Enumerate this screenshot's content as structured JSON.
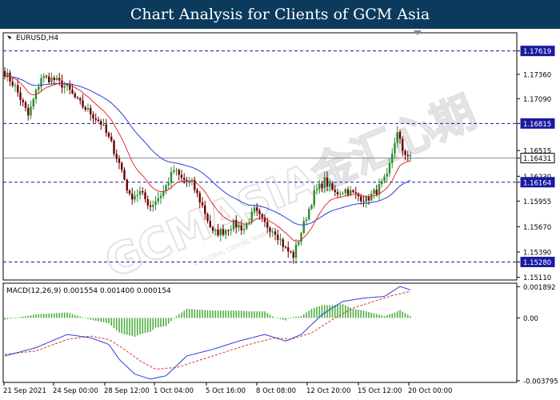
{
  "banner": {
    "title": "Chart Analysis for Clients of GCM Asia"
  },
  "watermark": {
    "text": "GCMASIA金汇心期",
    "subtext": "© GLOBAL CAPITAL MARKETS"
  },
  "colors": {
    "banner": "#0b3a5c",
    "bull_candle": "#2e8b2e",
    "bear_candle": "#6b0000",
    "ma_fast": "#e03030",
    "ma_slow": "#2a3fd6",
    "level": "#1a1aa0",
    "price_line": "#7a8aa0",
    "macd_hist": "#4caf40",
    "macd_line": "#2a3fd6",
    "signal_line": "#e03030"
  },
  "chart_data": [
    {
      "type": "candlestick",
      "title": "EURUSD,H4",
      "x_labels": [
        "21 Sep 2021",
        "24 Sep 00:00",
        "28 Sep 12:00",
        "1 Oct 04:00",
        "5 Oct 16:00",
        "8 Oct 08:00",
        "12 Oct 20:00",
        "15 Oct 12:00",
        "20 Oct 00:00"
      ],
      "y_ticks": [
        1.17619,
        1.1736,
        1.1709,
        1.16815,
        1.16515,
        1.1623,
        1.16164,
        1.15955,
        1.1567,
        1.1539,
        1.1528,
        1.1511
      ],
      "ylim": [
        1.1508,
        1.1782
      ],
      "current_price": 1.16431,
      "horizontal_levels": [
        1.17619,
        1.16815,
        1.16164,
        1.1528
      ],
      "highlighted_labels": [
        "1.17619",
        "1.16815",
        "1.16431",
        "1.16164",
        "1.15280"
      ],
      "axis_label_texts": [
        "1.17619",
        "1.17360",
        "1.17090",
        "1.16815",
        "1.16515",
        "1.16431",
        "1.16230",
        "1.16164",
        "1.15955",
        "1.15670",
        "1.15390",
        "1.15280",
        "1.15110"
      ],
      "series": [
        {
          "name": "price",
          "key_close_points": [
            [
              0,
              1.1738
            ],
            [
              4,
              1.1722
            ],
            [
              9,
              1.169
            ],
            [
              14,
              1.1733
            ],
            [
              19,
              1.173
            ],
            [
              24,
              1.1721
            ],
            [
              28,
              1.1706
            ],
            [
              33,
              1.1693
            ],
            [
              37,
              1.1682
            ],
            [
              41,
              1.1659
            ],
            [
              45,
              1.163
            ],
            [
              48,
              1.16
            ],
            [
              52,
              1.1605
            ],
            [
              56,
              1.159
            ],
            [
              61,
              1.1606
            ],
            [
              65,
              1.163
            ],
            [
              68,
              1.162
            ],
            [
              72,
              1.1615
            ],
            [
              76,
              1.159
            ],
            [
              80,
              1.156
            ],
            [
              84,
              1.1562
            ],
            [
              88,
              1.157
            ],
            [
              92,
              1.1565
            ],
            [
              96,
              1.1585
            ],
            [
              100,
              1.157
            ],
            [
              104,
              1.1562
            ],
            [
              108,
              1.1542
            ],
            [
              111,
              1.1535
            ],
            [
              115,
              1.157
            ],
            [
              119,
              1.1604
            ],
            [
              123,
              1.1618
            ],
            [
              127,
              1.1604
            ],
            [
              131,
              1.1608
            ],
            [
              135,
              1.1602
            ],
            [
              139,
              1.1597
            ],
            [
              143,
              1.1607
            ],
            [
              147,
              1.1622
            ],
            [
              150,
              1.1662
            ],
            [
              151,
              1.167
            ],
            [
              153,
              1.1652
            ],
            [
              156,
              1.1643
            ]
          ]
        }
      ]
    },
    {
      "type": "line",
      "title": "MACD(12,26,9) 0.001554 0.001400 0.000154",
      "y_ticks": [
        0.001892,
        0.0,
        -0.003795
      ],
      "axis_label_texts": [
        "0.001892",
        "0.00",
        "-0.003795"
      ],
      "ylim": [
        -0.0039,
        0.0021
      ],
      "series": [
        {
          "name": "macd",
          "key_points": [
            [
              0,
              -0.0023
            ],
            [
              12,
              -0.0018
            ],
            [
              24,
              -0.001
            ],
            [
              33,
              -0.0012
            ],
            [
              40,
              -0.0016
            ],
            [
              44,
              -0.0025
            ],
            [
              50,
              -0.0034
            ],
            [
              56,
              -0.0037
            ],
            [
              62,
              -0.0035
            ],
            [
              70,
              -0.0023
            ],
            [
              80,
              -0.0019
            ],
            [
              90,
              -0.0014
            ],
            [
              100,
              -0.001
            ],
            [
              108,
              -0.0014
            ],
            [
              114,
              -0.001
            ],
            [
              122,
              0.0002
            ],
            [
              130,
              0.001
            ],
            [
              138,
              0.0012
            ],
            [
              146,
              0.0013
            ],
            [
              152,
              0.0019
            ],
            [
              156,
              0.0017
            ]
          ]
        },
        {
          "name": "signal",
          "key_points": [
            [
              0,
              -0.0022
            ],
            [
              12,
              -0.002
            ],
            [
              24,
              -0.0013
            ],
            [
              33,
              -0.0011
            ],
            [
              40,
              -0.0013
            ],
            [
              46,
              -0.0019
            ],
            [
              52,
              -0.0026
            ],
            [
              58,
              -0.0031
            ],
            [
              66,
              -0.003
            ],
            [
              74,
              -0.0026
            ],
            [
              84,
              -0.0021
            ],
            [
              94,
              -0.0016
            ],
            [
              104,
              -0.0012
            ],
            [
              110,
              -0.0013
            ],
            [
              118,
              -0.0009
            ],
            [
              126,
              -0.0001
            ],
            [
              134,
              0.0006
            ],
            [
              142,
              0.001
            ],
            [
              150,
              0.0014
            ],
            [
              156,
              0.0016
            ]
          ]
        }
      ]
    }
  ]
}
